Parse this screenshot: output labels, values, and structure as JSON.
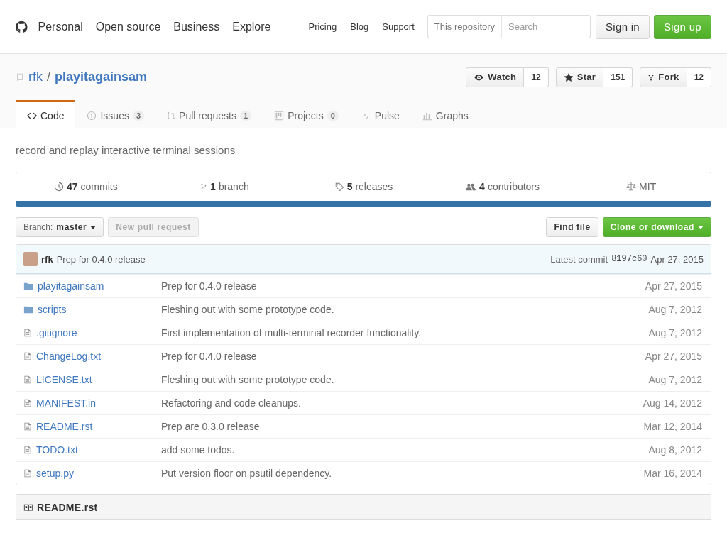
{
  "header": {
    "nav": [
      "Personal",
      "Open source",
      "Business",
      "Explore"
    ],
    "links": [
      "Pricing",
      "Blog",
      "Support"
    ],
    "search": {
      "scope": "This repository",
      "placeholder": "Search"
    },
    "sign_in": "Sign in",
    "sign_up": "Sign up"
  },
  "repo": {
    "owner": "rfk",
    "separator": "/",
    "name": "playitagainsam",
    "actions": [
      {
        "kind": "watch",
        "label": "Watch",
        "count": "12"
      },
      {
        "kind": "star",
        "label": "Star",
        "count": "151"
      },
      {
        "kind": "fork",
        "label": "Fork",
        "count": "12"
      }
    ]
  },
  "tabs": [
    {
      "kind": "code",
      "label": "Code",
      "selected": true
    },
    {
      "kind": "issues",
      "label": "Issues",
      "count": "3",
      "selected": false
    },
    {
      "kind": "pulls",
      "label": "Pull requests",
      "count": "1",
      "selected": false
    },
    {
      "kind": "projects",
      "label": "Projects",
      "count": "0",
      "selected": false
    },
    {
      "kind": "pulse",
      "label": "Pulse",
      "selected": false
    },
    {
      "kind": "graphs",
      "label": "Graphs",
      "selected": false
    }
  ],
  "description": "record and replay interactive terminal sessions",
  "summary": [
    {
      "kind": "commits",
      "count": "47",
      "label": "commits"
    },
    {
      "kind": "branch",
      "count": "1",
      "label": "branch"
    },
    {
      "kind": "releases",
      "count": "5",
      "label": "releases"
    },
    {
      "kind": "contributors",
      "count": "4",
      "label": "contributors"
    },
    {
      "kind": "license",
      "label": "MIT"
    }
  ],
  "toolbar": {
    "branch_label": "Branch:",
    "branch": "master",
    "new_pull_request": {
      "label": "New pull request",
      "disabled": true
    },
    "find_file": "Find file",
    "clone": "Clone or download"
  },
  "commit": {
    "author": "rfk",
    "message": "Prep for 0.4.0 release",
    "latest_label": "Latest commit",
    "sha": "8197c60",
    "date": "Apr 27, 2015"
  },
  "files": [
    {
      "kind": "dir",
      "name": "playitagainsam",
      "message": "Prep for 0.4.0 release",
      "date": "Apr 27, 2015"
    },
    {
      "kind": "dir",
      "name": "scripts",
      "message": "Fleshing out with some prototype code.",
      "date": "Aug 7, 2012"
    },
    {
      "kind": "file",
      "name": ".gitignore",
      "message": "First implementation of multi-terminal recorder functionality.",
      "date": "Aug 7, 2012"
    },
    {
      "kind": "file",
      "name": "ChangeLog.txt",
      "message": "Prep for 0.4.0 release",
      "date": "Apr 27, 2015"
    },
    {
      "kind": "file",
      "name": "LICENSE.txt",
      "message": "Fleshing out with some prototype code.",
      "date": "Aug 7, 2012"
    },
    {
      "kind": "file",
      "name": "MANIFEST.in",
      "message": "Refactoring and code cleanups.",
      "date": "Aug 14, 2012"
    },
    {
      "kind": "file",
      "name": "README.rst",
      "message": "Prep are 0.3.0 release",
      "date": "Mar 12, 2014"
    },
    {
      "kind": "file",
      "name": "TODO.txt",
      "message": "add some todos.",
      "date": "Aug 8, 2012"
    },
    {
      "kind": "file",
      "name": "setup.py",
      "message": "Put version floor on psutil dependency.",
      "date": "Mar 16, 2014"
    }
  ],
  "readme": {
    "title": "README.rst"
  }
}
